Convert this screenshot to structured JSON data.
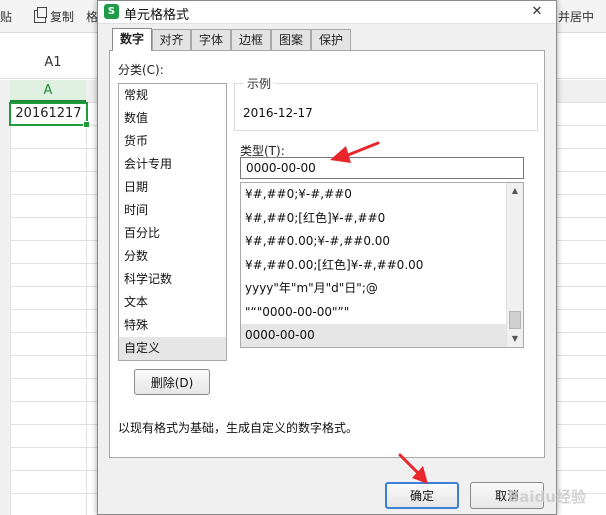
{
  "toolbar": {
    "paste_partial": "贴",
    "copy_label": "复制",
    "format_partial": "格",
    "merge_partial": "并居中"
  },
  "formula_bar": {
    "name_box": "A1"
  },
  "sheet": {
    "column_a": "A",
    "cell_a1_value": "20161217"
  },
  "dialog": {
    "title": "单元格格式",
    "app_icon": "S",
    "close_glyph": "✕",
    "tabs": [
      "数字",
      "对齐",
      "字体",
      "边框",
      "图案",
      "保护"
    ],
    "active_tab": "数字",
    "category_label": "分类(C):",
    "categories": [
      "常规",
      "数值",
      "货币",
      "会计专用",
      "日期",
      "时间",
      "百分比",
      "分数",
      "科学记数",
      "文本",
      "特殊",
      "自定义"
    ],
    "selected_category": "自定义",
    "sample_legend": "示例",
    "sample_value": "2016-12-17",
    "type_label": "类型(T):",
    "type_value": "0000-00-00",
    "formats": [
      "¥#,##0;¥-#,##0",
      "¥#,##0;[红色]¥-#,##0",
      "¥#,##0.00;¥-#,##0.00",
      "¥#,##0.00;[红色]¥-#,##0.00",
      "yyyy\"年\"m\"月\"d\"日\";@",
      "\"“\"0000-00-00\"”\"",
      "0000-00-00"
    ],
    "selected_format": "0000-00-00",
    "delete_label": "删除(D)",
    "hint": "以现有格式为基础，生成自定义的数字格式。",
    "ok_label": "确定",
    "cancel_label": "取消"
  },
  "colors": {
    "accent_green": "#1f9a3c",
    "annotation_red": "#e8262b",
    "focus_blue": "#3c7fd6"
  },
  "watermark": "Baidu经验"
}
